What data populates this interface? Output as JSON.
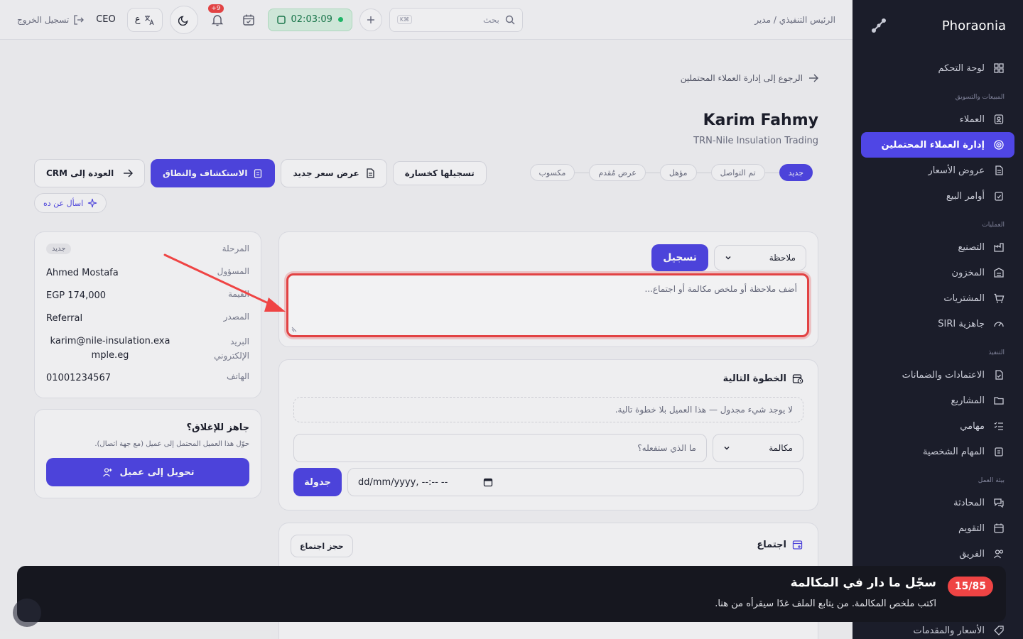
{
  "brand": {
    "name": "Phoraonia"
  },
  "sidebar": {
    "dashboard": "لوحة التحكم",
    "section_sales": "المبيعات والتسويق",
    "customers": "العملاء",
    "leads": "إدارة العملاء المحتملين",
    "quotes": "عروض الأسعار",
    "sales_orders": "أوامر البيع",
    "section_ops": "العمليات",
    "manufacturing": "التصنيع",
    "inventory": "المخزون",
    "purchases": "المشتريات",
    "siri": "جاهزية SIRI",
    "section_exec": "التنفيذ",
    "approvals": "الاعتمادات والضمانات",
    "projects": "المشاريع",
    "tasks": "مهامي",
    "personal_tasks": "المهام الشخصية",
    "section_work": "بيئة العمل",
    "chat": "المحادثة",
    "calendar": "التقويم",
    "team": "الفريق",
    "pricing": "الأسعار والمقدمات"
  },
  "topbar": {
    "breadcrumb": "الرئيس التنفيذي / مدير",
    "search_placeholder": "بحث",
    "search_kbd": "K⌘",
    "timer": "02:03:09",
    "notif_count": "+9",
    "lang_label": "ع",
    "role": "CEO",
    "logout": "تسجيل الخروج"
  },
  "header": {
    "back": "الرجوع إلى إدارة العملاء المحتملين",
    "title": "Karim Fahmy",
    "subtitle": "TRN-Nile Insulation Trading"
  },
  "stages": [
    "جديد",
    "تم التواصل",
    "مؤهل",
    "عرض مُقدم",
    "مكسوب"
  ],
  "actions": {
    "mark_lost": "تسجيلها كخسارة",
    "new_quote": "عرض سعر جديد",
    "discovery": "الاستكشاف والنطاق",
    "back_crm": "العودة إلى CRM",
    "ask": "اسأل عن ده"
  },
  "info": {
    "stage_label": "المرحلة",
    "stage_value": "جديد",
    "owner_label": "المسؤول",
    "owner_value": "Ahmed Mostafa",
    "value_label": "القيمة",
    "value_value": "EGP 174,000",
    "source_label": "المصدر",
    "source_value": "Referral",
    "email_label": "البريد الإلكتروني",
    "email_value": "karim@nile-insulation.example.eg",
    "phone_label": "الهاتف",
    "phone_value": "01001234567"
  },
  "close": {
    "title": "جاهز للإغلاق؟",
    "desc": "حوّل هذا العميل المحتمل إلى عميل (مع جهة اتصال).",
    "button": "تحويل إلى عميل"
  },
  "note": {
    "type": "ملاحظة",
    "record": "تسجيل",
    "placeholder": "أضف ملاحظة أو ملخص مكالمة أو اجتماع..."
  },
  "next_step": {
    "title": "الخطوة التالية",
    "empty": "لا يوجد شيء مجدول — هذا العميل بلا خطوة تالية.",
    "type": "مكالمة",
    "what_placeholder": "ما الذي ستفعله؟",
    "datetime": "dd/mm/yyyy, --:-- --",
    "schedule": "جدولة"
  },
  "meeting": {
    "title": "اجتماع",
    "book": "حجز اجتماع"
  },
  "tour": {
    "count": "15/85",
    "title": "سجّل ما دار في المكالمة",
    "desc": "اكتب ملخص المكالمة. من يتابع الملف غدًا سيقرأه من هنا."
  },
  "colors": {
    "accent": "#4f46e5",
    "sidebar": "#1b1d2a",
    "highlight": "#ef4444",
    "timer": "#17794a"
  }
}
